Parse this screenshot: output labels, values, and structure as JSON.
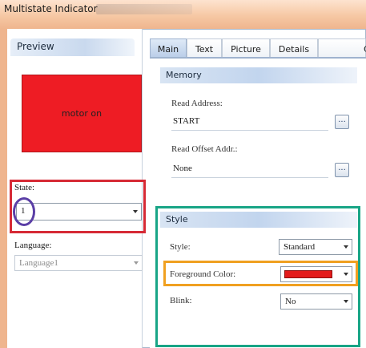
{
  "window": {
    "title": "Multistate Indicator"
  },
  "preview": {
    "header": "Preview",
    "box_text": "motor on",
    "box_color": "#ee1c24",
    "state_label": "State:",
    "state_value": "1",
    "language_label": "Language:",
    "language_value": "Language1"
  },
  "tabs": [
    {
      "label": "Main",
      "active": true
    },
    {
      "label": "Text",
      "active": false
    },
    {
      "label": "Picture",
      "active": false
    },
    {
      "label": "Details",
      "active": false
    },
    {
      "label": "C",
      "active": false
    }
  ],
  "memory": {
    "header": "Memory",
    "read_address_label": "Read Address:",
    "read_address_value": "START",
    "read_offset_label": "Read Offset Addr.:",
    "read_offset_value": "None",
    "browse_label": "..."
  },
  "style": {
    "header": "Style",
    "style_label": "Style:",
    "style_value": "Standard",
    "fg_label": "Foreground Color:",
    "fg_color": "#e31b1b",
    "blink_label": "Blink:",
    "blink_value": "No"
  },
  "highlights": {
    "state_box_color": "#d62a35",
    "state_circle_color": "#5b3fa6",
    "style_box_color": "#18a586",
    "fg_box_color": "#f0a020"
  }
}
